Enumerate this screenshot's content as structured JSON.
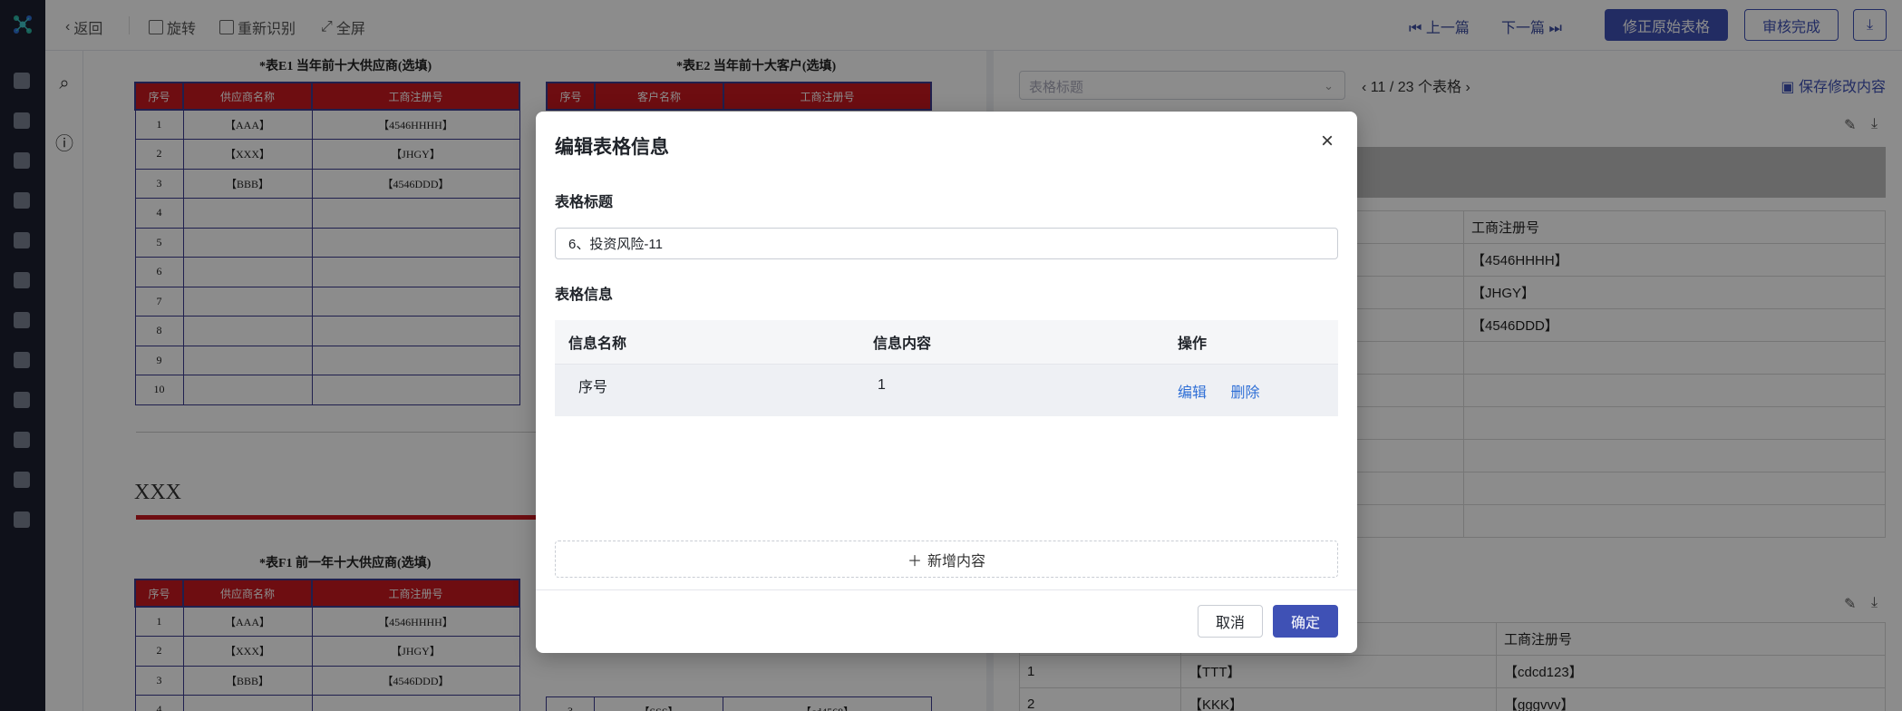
{
  "toolbar": {
    "back_label": "返回",
    "rotate_label": "旋转",
    "reocr_label": "重新识别",
    "fullscreen_label": "全屏",
    "prev_label": "上一篇",
    "next_label": "下一篇",
    "fix_label": "修正原始表格",
    "approve_label": "审核完成"
  },
  "doc": {
    "table_e1_title": "*表E1 当年前十大供应商(选填)",
    "table_e2_title": "*表E2 当年前十大客户(选填)",
    "table_f1_title": "*表F1 前一年十大供应商(选填)",
    "section_heading": "XXX",
    "e1": {
      "headers": [
        "序号",
        "供应商名称",
        "工商注册号"
      ],
      "rows": [
        [
          "1",
          "【AAA】",
          "【4546HHHH】"
        ],
        [
          "2",
          "【XXX】",
          "【JHGY】"
        ],
        [
          "3",
          "【BBB】",
          "【4546DDD】"
        ],
        [
          "4",
          "",
          ""
        ],
        [
          "5",
          "",
          ""
        ],
        [
          "6",
          "",
          ""
        ],
        [
          "7",
          "",
          ""
        ],
        [
          "8",
          "",
          ""
        ],
        [
          "9",
          "",
          ""
        ],
        [
          "10",
          "",
          ""
        ]
      ]
    },
    "e2": {
      "headers": [
        "序号",
        "客户名称",
        "工商注册号"
      ]
    },
    "f1": {
      "headers": [
        "序号",
        "供应商名称",
        "工商注册号"
      ],
      "rows": [
        [
          "1",
          "【AAA】",
          "【4546HHHH】"
        ],
        [
          "2",
          "【XXX】",
          "【JHGY】"
        ],
        [
          "3",
          "【BBB】",
          "【4546DDD】"
        ],
        [
          "4",
          "",
          ""
        ]
      ]
    },
    "f2_partial": [
      [
        "3",
        "【SSS】",
        "【cd4568】"
      ]
    ]
  },
  "right": {
    "select_placeholder": "表格标题",
    "pager": "11 / 23 个表格",
    "save_label": "保存修改内容",
    "top_table": {
      "header": "工商注册号",
      "rows": [
        "【4546HHHH】",
        "【JHGY】",
        "【4546DDD】",
        "",
        "",
        "",
        "",
        "",
        "",
        ""
      ]
    },
    "bottom_table": {
      "header": "工商注册号",
      "rows": [
        [
          "1",
          "【TTT】",
          "【cdcd123】"
        ],
        [
          "2",
          "【KKK】",
          "【gggvvv】"
        ]
      ]
    }
  },
  "modal": {
    "title": "编辑表格信息",
    "title_label": "表格标题",
    "title_value": "6、投资风险-11",
    "info_label": "表格信息",
    "columns": [
      "信息名称",
      "信息内容",
      "操作"
    ],
    "rows": [
      {
        "name": "序号",
        "content": "1",
        "edit": "编辑",
        "delete": "删除"
      }
    ],
    "add_label": "新增内容",
    "cancel_label": "取消",
    "ok_label": "确定"
  },
  "colors": {
    "accent": "#3f51b5",
    "table_header_red": "#c8191f",
    "table_border_blue": "#3b3b8f",
    "link_blue": "#2f6fd6"
  }
}
